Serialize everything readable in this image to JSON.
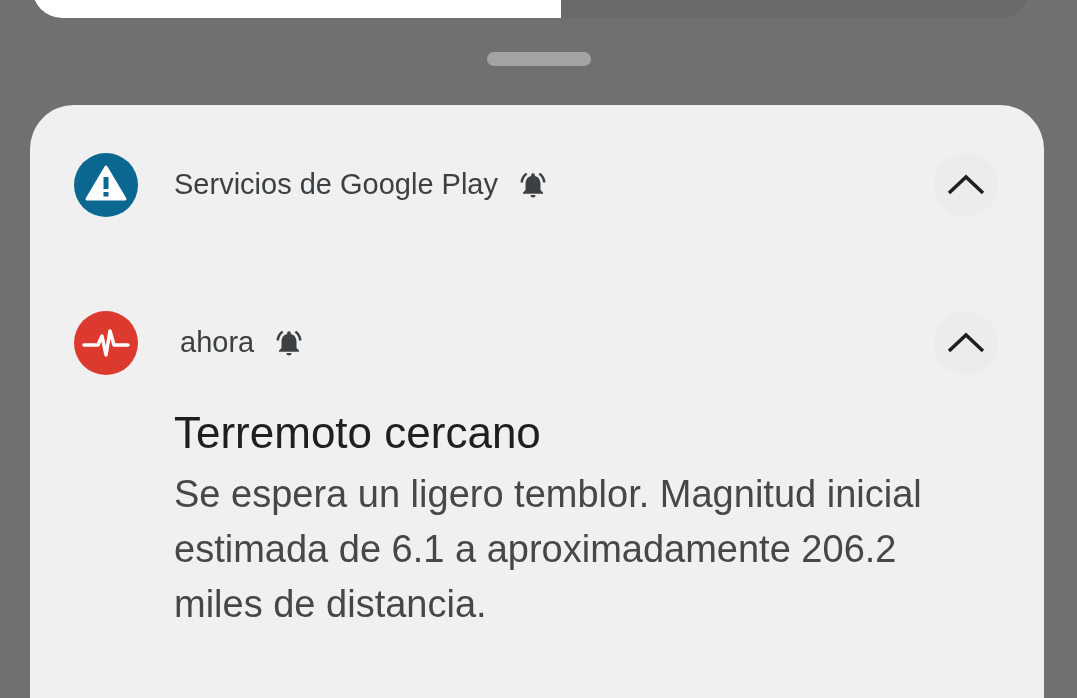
{
  "brightness_slider": {
    "level": 0.53
  },
  "notifications": [
    {
      "kind": "group",
      "app": "Servicios de Google Play",
      "alerting": true,
      "expanded": true
    },
    {
      "kind": "alert",
      "time": "ahora",
      "alerting": true,
      "expanded": true,
      "title": "Terremoto cercano",
      "body": "Se espera un ligero temblor. Magnitud inicial estimada de 6.1 a aproximadamente 206.2 miles de distancia."
    }
  ]
}
